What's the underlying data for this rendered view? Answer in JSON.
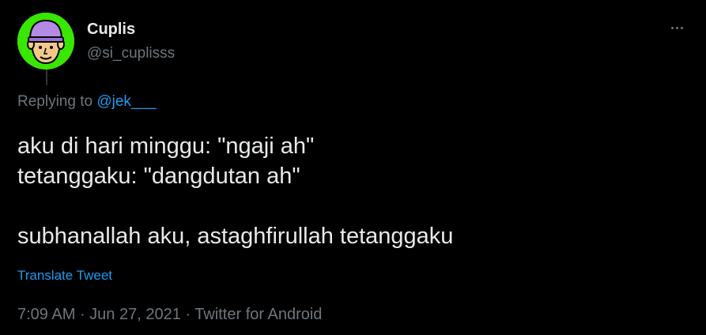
{
  "author": {
    "display_name": "Cuplis",
    "handle": "@si_cuplisss",
    "avatar_icon": "cartoon-face-avatar",
    "avatar_bg": "#39e600"
  },
  "more_icon": "more-horizontal-icon",
  "reply": {
    "prefix": "Replying to ",
    "mention": "@jek___"
  },
  "tweet": {
    "lines": [
      "aku di hari minggu: \"ngaji ah\"",
      "tetanggaku: \"dangdutan ah\"",
      "",
      "subhanallah aku, astaghfirullah tetanggaku"
    ]
  },
  "translate_label": "Translate Tweet",
  "meta": {
    "time": "7:09 AM",
    "separator": " · ",
    "date": "Jun 27, 2021",
    "source": "Twitter for Android"
  },
  "colors": {
    "background": "#000000",
    "primary_text": "#e7e9ea",
    "secondary_text": "#6e767d",
    "link": "#1d9bf0"
  }
}
